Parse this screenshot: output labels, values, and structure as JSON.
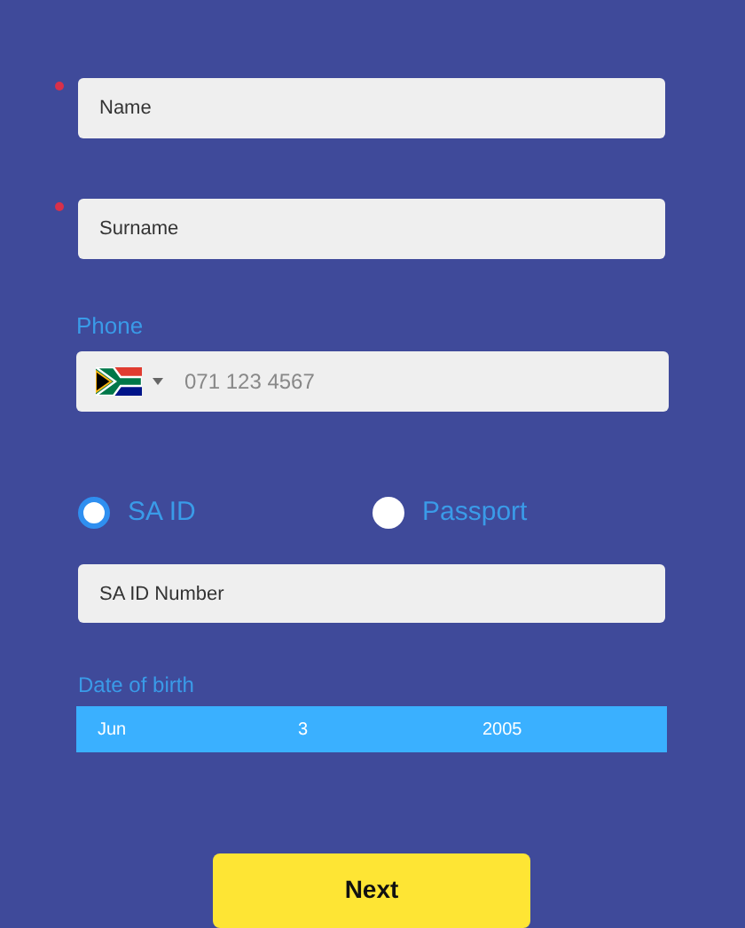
{
  "fields": [
    {
      "placeholder": "Name",
      "required": true
    },
    {
      "placeholder": "Surname",
      "required": true
    }
  ],
  "phone": {
    "label": "Phone",
    "placeholder": "071 123 4567"
  },
  "id_types": [
    {
      "label": "SA ID",
      "selected": true
    },
    {
      "label": "Passport",
      "selected": false
    }
  ],
  "id_field": {
    "placeholder": "SA ID Number"
  },
  "date_of_birth": {
    "label": "Date of birth",
    "month": "Jun",
    "day": "3",
    "year": "2005"
  },
  "next_button": "Next"
}
